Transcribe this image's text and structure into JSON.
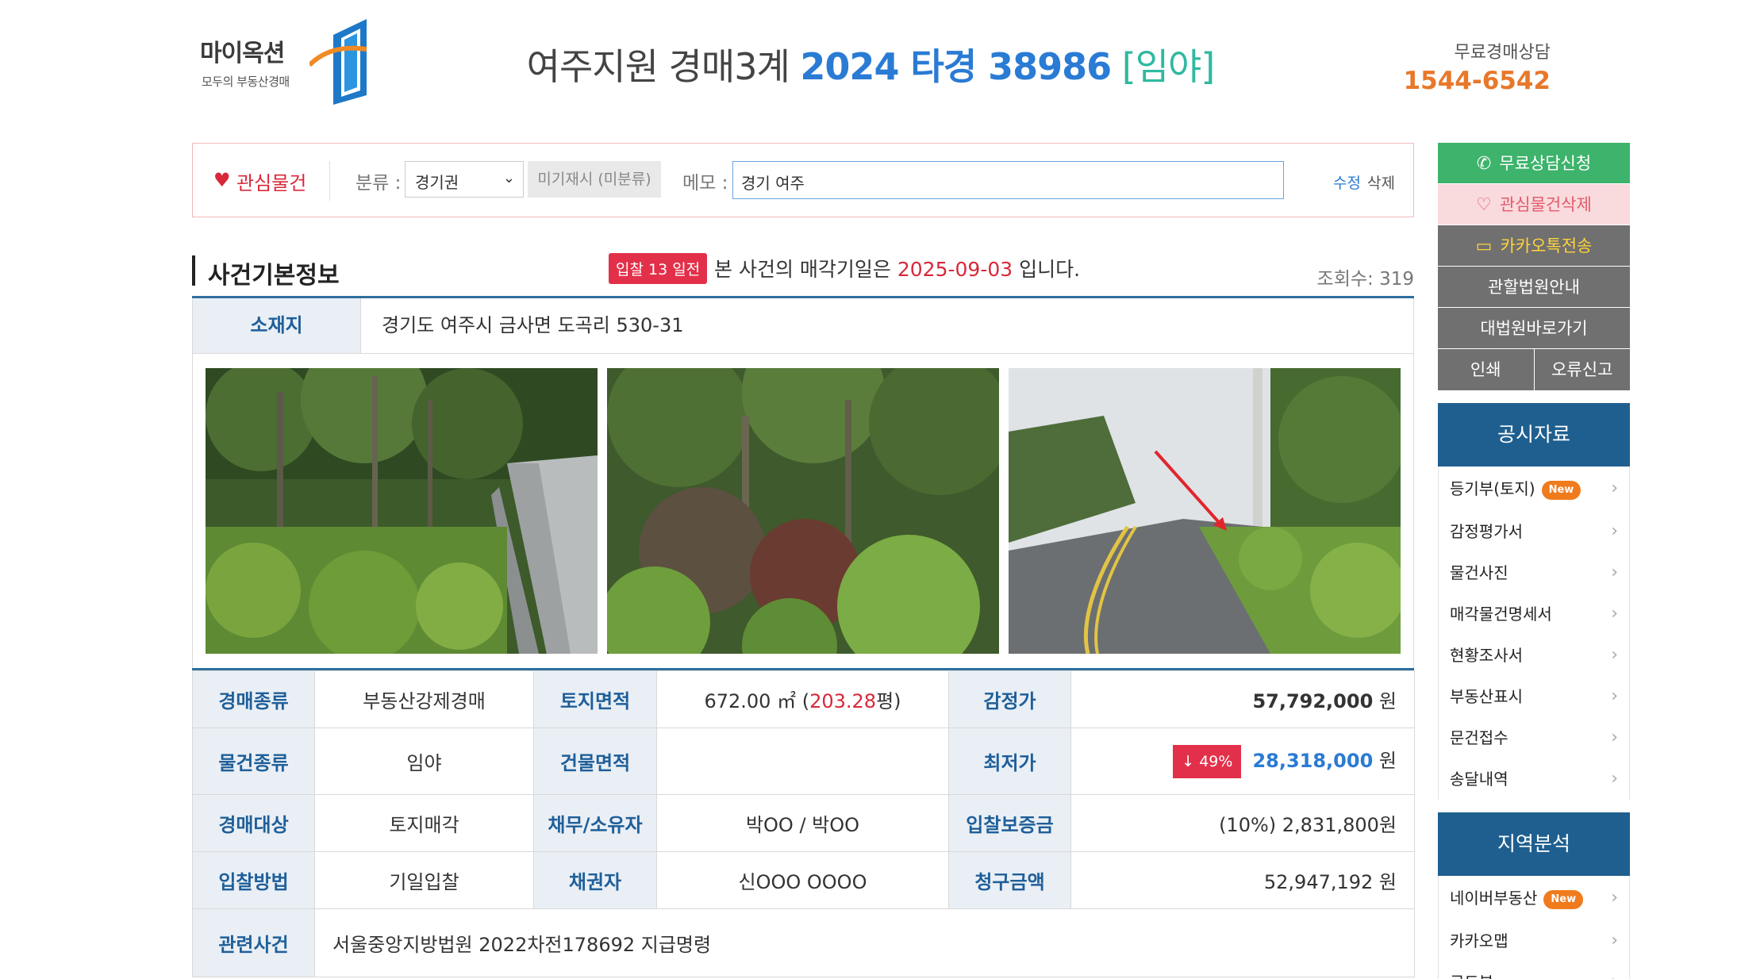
{
  "header": {
    "logo_text": "마이옥션",
    "logo_sub": "모두의 부동산경매",
    "court": "여주지원 경매3계",
    "case_number": "2024 타경 38986",
    "property_type": "[임야]",
    "consult_label": "무료경매상담",
    "consult_phone": "1544-6542"
  },
  "interest": {
    "title": "관심물건",
    "category_label": "분류 :",
    "category_value": "경기권",
    "unclassified": "미기재시 (미분류)",
    "memo_label": "메모 :",
    "memo_value": "경기 여주",
    "edit": "수정",
    "delete": "삭제"
  },
  "section": {
    "title": "사건기본정보",
    "badge": "입찰 13 일전",
    "note_prefix": "본 사건의 매각기일은",
    "sale_date": "2025-09-03",
    "note_suffix": "입니다.",
    "views": "조회수: 319"
  },
  "location": {
    "label": "소재지",
    "value": "경기도 여주시 금사면 도곡리 530-31"
  },
  "info": {
    "r1": {
      "l1": "경매종류",
      "v1": "부동산강제경매",
      "l2": "토지면적",
      "area": "672.00 ㎡ (",
      "pyeong": "203.28",
      "pyeong_unit": "평)",
      "l3": "감정가",
      "appraisal": "57,792,000",
      "won": "원"
    },
    "r2": {
      "l1": "물건종류",
      "v1": "임야",
      "l2": "건물면적",
      "v2": "",
      "l3": "최저가",
      "drop": "↓ 49%",
      "min_price": "28,318,000",
      "won": "원"
    },
    "r3": {
      "l1": "경매대상",
      "v1": "토지매각",
      "l2": "채무/소유자",
      "v2": "박OO / 박OO",
      "l3": "입찰보증금",
      "v3": "(10%) 2,831,800원"
    },
    "r4": {
      "l1": "입찰방법",
      "v1": "기일입찰",
      "l2": "채권자",
      "v2": "신OOO OOOO",
      "l3": "청구금액",
      "v3": "52,947,192 원"
    },
    "r5": {
      "l1": "관련사건",
      "v1": "서울중앙지방법원 2022차전178692 지급명령"
    }
  },
  "sidebar": {
    "free_consult": "무료상담신청",
    "remove_interest": "관심물건삭제",
    "kakao_send": "카카오톡전송",
    "court_guide": "관할법원안내",
    "supreme_court": "대법원바로가기",
    "print": "인쇄",
    "report_error": "오류신고",
    "public_head": "공시자료",
    "public_items": [
      "등기부(토지)",
      "감정평가서",
      "물건사진",
      "매각물건명세서",
      "현황조사서",
      "부동산표시",
      "문건접수",
      "송달내역"
    ],
    "region_head": "지역분석",
    "region_items": [
      "네이버부동산",
      "카카오맵",
      "로드뷰"
    ],
    "new_badge": "New"
  }
}
